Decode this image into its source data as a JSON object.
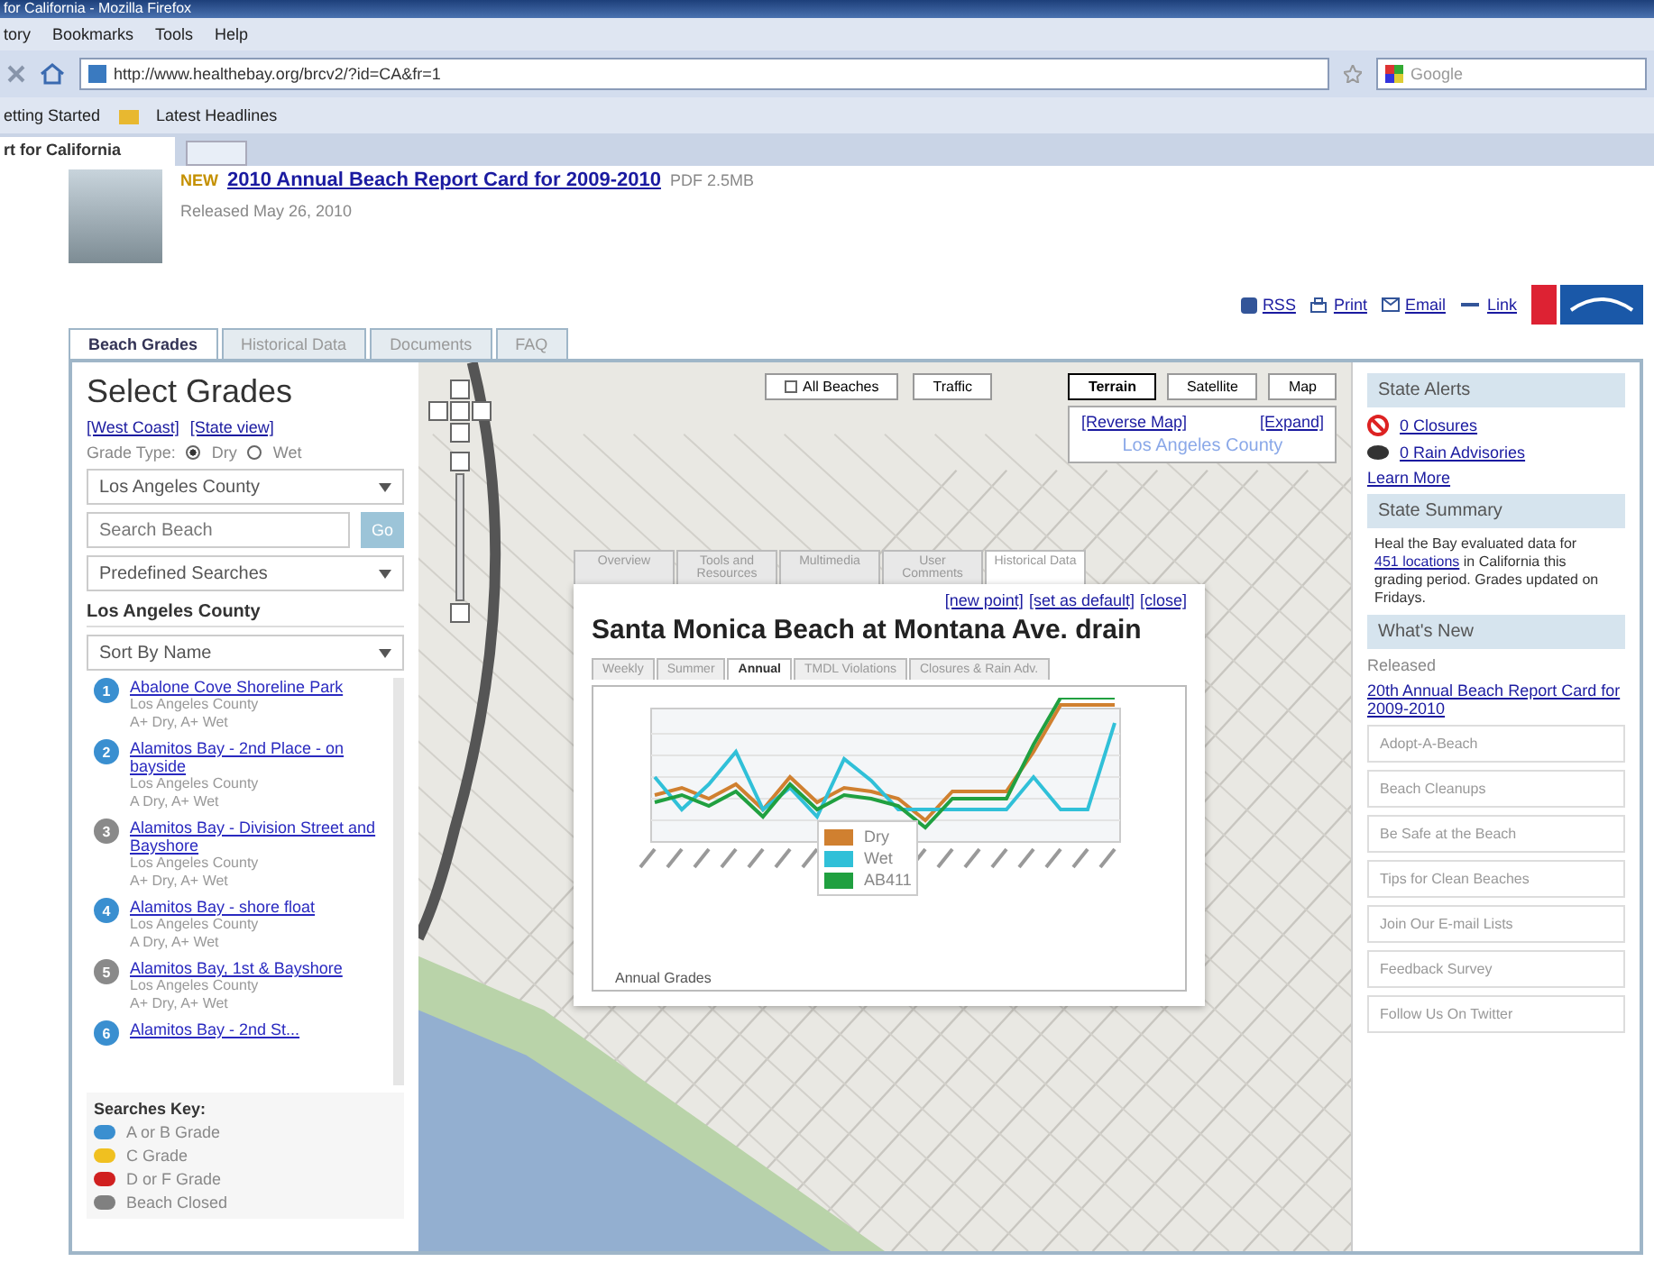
{
  "browser": {
    "title": "for California - Mozilla Firefox",
    "menu": [
      "tory",
      "Bookmarks",
      "Tools",
      "Help"
    ],
    "url": "http://www.healthebay.org/brcv2/?id=CA&fr=1",
    "search_placeholder": "Google",
    "bookmarks": [
      "etting Started",
      "Latest Headlines"
    ],
    "tab": "rt for California"
  },
  "header": {
    "badge": "NEW",
    "link": "2010 Annual Beach Report Card for 2009-2010",
    "size": "PDF 2.5MB",
    "released": "Released May 26, 2010"
  },
  "tools": [
    {
      "kind": "rss",
      "label": "RSS"
    },
    {
      "kind": "print",
      "label": "Print"
    },
    {
      "kind": "email",
      "label": "Email"
    },
    {
      "kind": "link",
      "label": "Link"
    }
  ],
  "tabs": [
    {
      "label": "Beach Grades",
      "selected": true
    },
    {
      "label": "Historical Data",
      "selected": false
    },
    {
      "label": "Documents",
      "selected": false
    },
    {
      "label": "FAQ",
      "selected": false
    }
  ],
  "sidebar": {
    "title": "Select Grades",
    "views": [
      "[West Coast]",
      "[State view]"
    ],
    "grade_type_label": "Grade Type:",
    "grade_types": [
      {
        "label": "Dry",
        "selected": true
      },
      {
        "label": "Wet",
        "selected": false
      }
    ],
    "county": "Los Angeles County",
    "search_placeholder": "Search Beach",
    "go": "Go",
    "predefined": "Predefined Searches",
    "heading": "Los Angeles County",
    "sort": "Sort By Name",
    "beaches": [
      {
        "number": "1",
        "name": "Abalone Cove Shoreline Park",
        "county": "Los Angeles County",
        "grades": "A+ Dry, A+ Wet",
        "color": "#3a8fd0"
      },
      {
        "number": "2",
        "name": "Alamitos Bay - 2nd Place - on bayside",
        "county": "Los Angeles County",
        "grades": "A Dry, A+ Wet",
        "color": "#3a8fd0"
      },
      {
        "number": "3",
        "name": "Alamitos Bay - Division Street and Bayshore",
        "county": "Los Angeles County",
        "grades": "A+ Dry, A+ Wet",
        "color": "#8a8a8a"
      },
      {
        "number": "4",
        "name": "Alamitos Bay - shore float",
        "county": "Los Angeles County",
        "grades": "A Dry, A+ Wet",
        "color": "#3a8fd0"
      },
      {
        "number": "5",
        "name": "Alamitos Bay, 1st & Bayshore",
        "county": "Los Angeles County",
        "grades": "A+ Dry, A+ Wet",
        "color": "#8a8a8a"
      },
      {
        "number": "6",
        "name": "Alamitos Bay - 2nd St...",
        "color": "#3a8fd0"
      }
    ],
    "key_title": "Searches Key:",
    "key": [
      {
        "label": "A or B Grade",
        "color": "#3a8fd0"
      },
      {
        "label": "C Grade",
        "color": "#f0c020"
      },
      {
        "label": "D or F Grade",
        "color": "#d02020"
      },
      {
        "label": "Beach Closed",
        "color": "#808080"
      }
    ]
  },
  "map": {
    "layers": [
      {
        "label": "All Beaches",
        "kind": "check"
      },
      {
        "label": "Traffic",
        "kind": "button"
      }
    ],
    "types": [
      {
        "label": "Terrain",
        "selected": true
      },
      {
        "label": "Satellite",
        "selected": false
      },
      {
        "label": "Map",
        "selected": false
      }
    ],
    "reverse": "[Reverse Map]",
    "expand": "[Expand]",
    "area": "Los Angeles County"
  },
  "popup": {
    "tabs": [
      {
        "label": "Overview",
        "selected": false
      },
      {
        "label": "Tools and Resources",
        "selected": false
      },
      {
        "label": "Multimedia",
        "selected": false
      },
      {
        "label": "User Comments",
        "selected": false
      },
      {
        "label": "Historical Data",
        "selected": true
      }
    ],
    "links": [
      "[new point]",
      "[set as default]",
      "[close]"
    ],
    "title": "Santa Monica Beach at Montana Ave. drain",
    "chart_tabs": [
      {
        "label": "Weekly",
        "selected": false
      },
      {
        "label": "Summer",
        "selected": false
      },
      {
        "label": "Annual",
        "selected": true
      },
      {
        "label": "TMDL Violations",
        "selected": false
      },
      {
        "label": "Closures & Rain Adv.",
        "selected": false
      }
    ],
    "legend": [
      {
        "label": "Dry",
        "color": "#d08030"
      },
      {
        "label": "Wet",
        "color": "#30c0d8"
      },
      {
        "label": "AB411",
        "color": "#20a040"
      }
    ],
    "caption": "Annual Grades"
  },
  "right": {
    "alerts_title": "State Alerts",
    "closures": "0 Closures",
    "rain": "0 Rain Advisories",
    "learn": "Learn More",
    "summary_title": "State Summary",
    "summary": "Heal the Bay evaluated data for **451 locations** in California this grading period. Grades updated on Fridays.",
    "new_title": "What's New",
    "released": "Released",
    "new_link": "20th Annual Beach Report Card for 2009-2010",
    "links": [
      "Adopt-A-Beach",
      "Beach Cleanups",
      "Be Safe at the Beach",
      "Tips for Clean Beaches",
      "Join Our E-mail Lists",
      "Feedback Survey",
      "Follow Us On Twitter"
    ]
  }
}
